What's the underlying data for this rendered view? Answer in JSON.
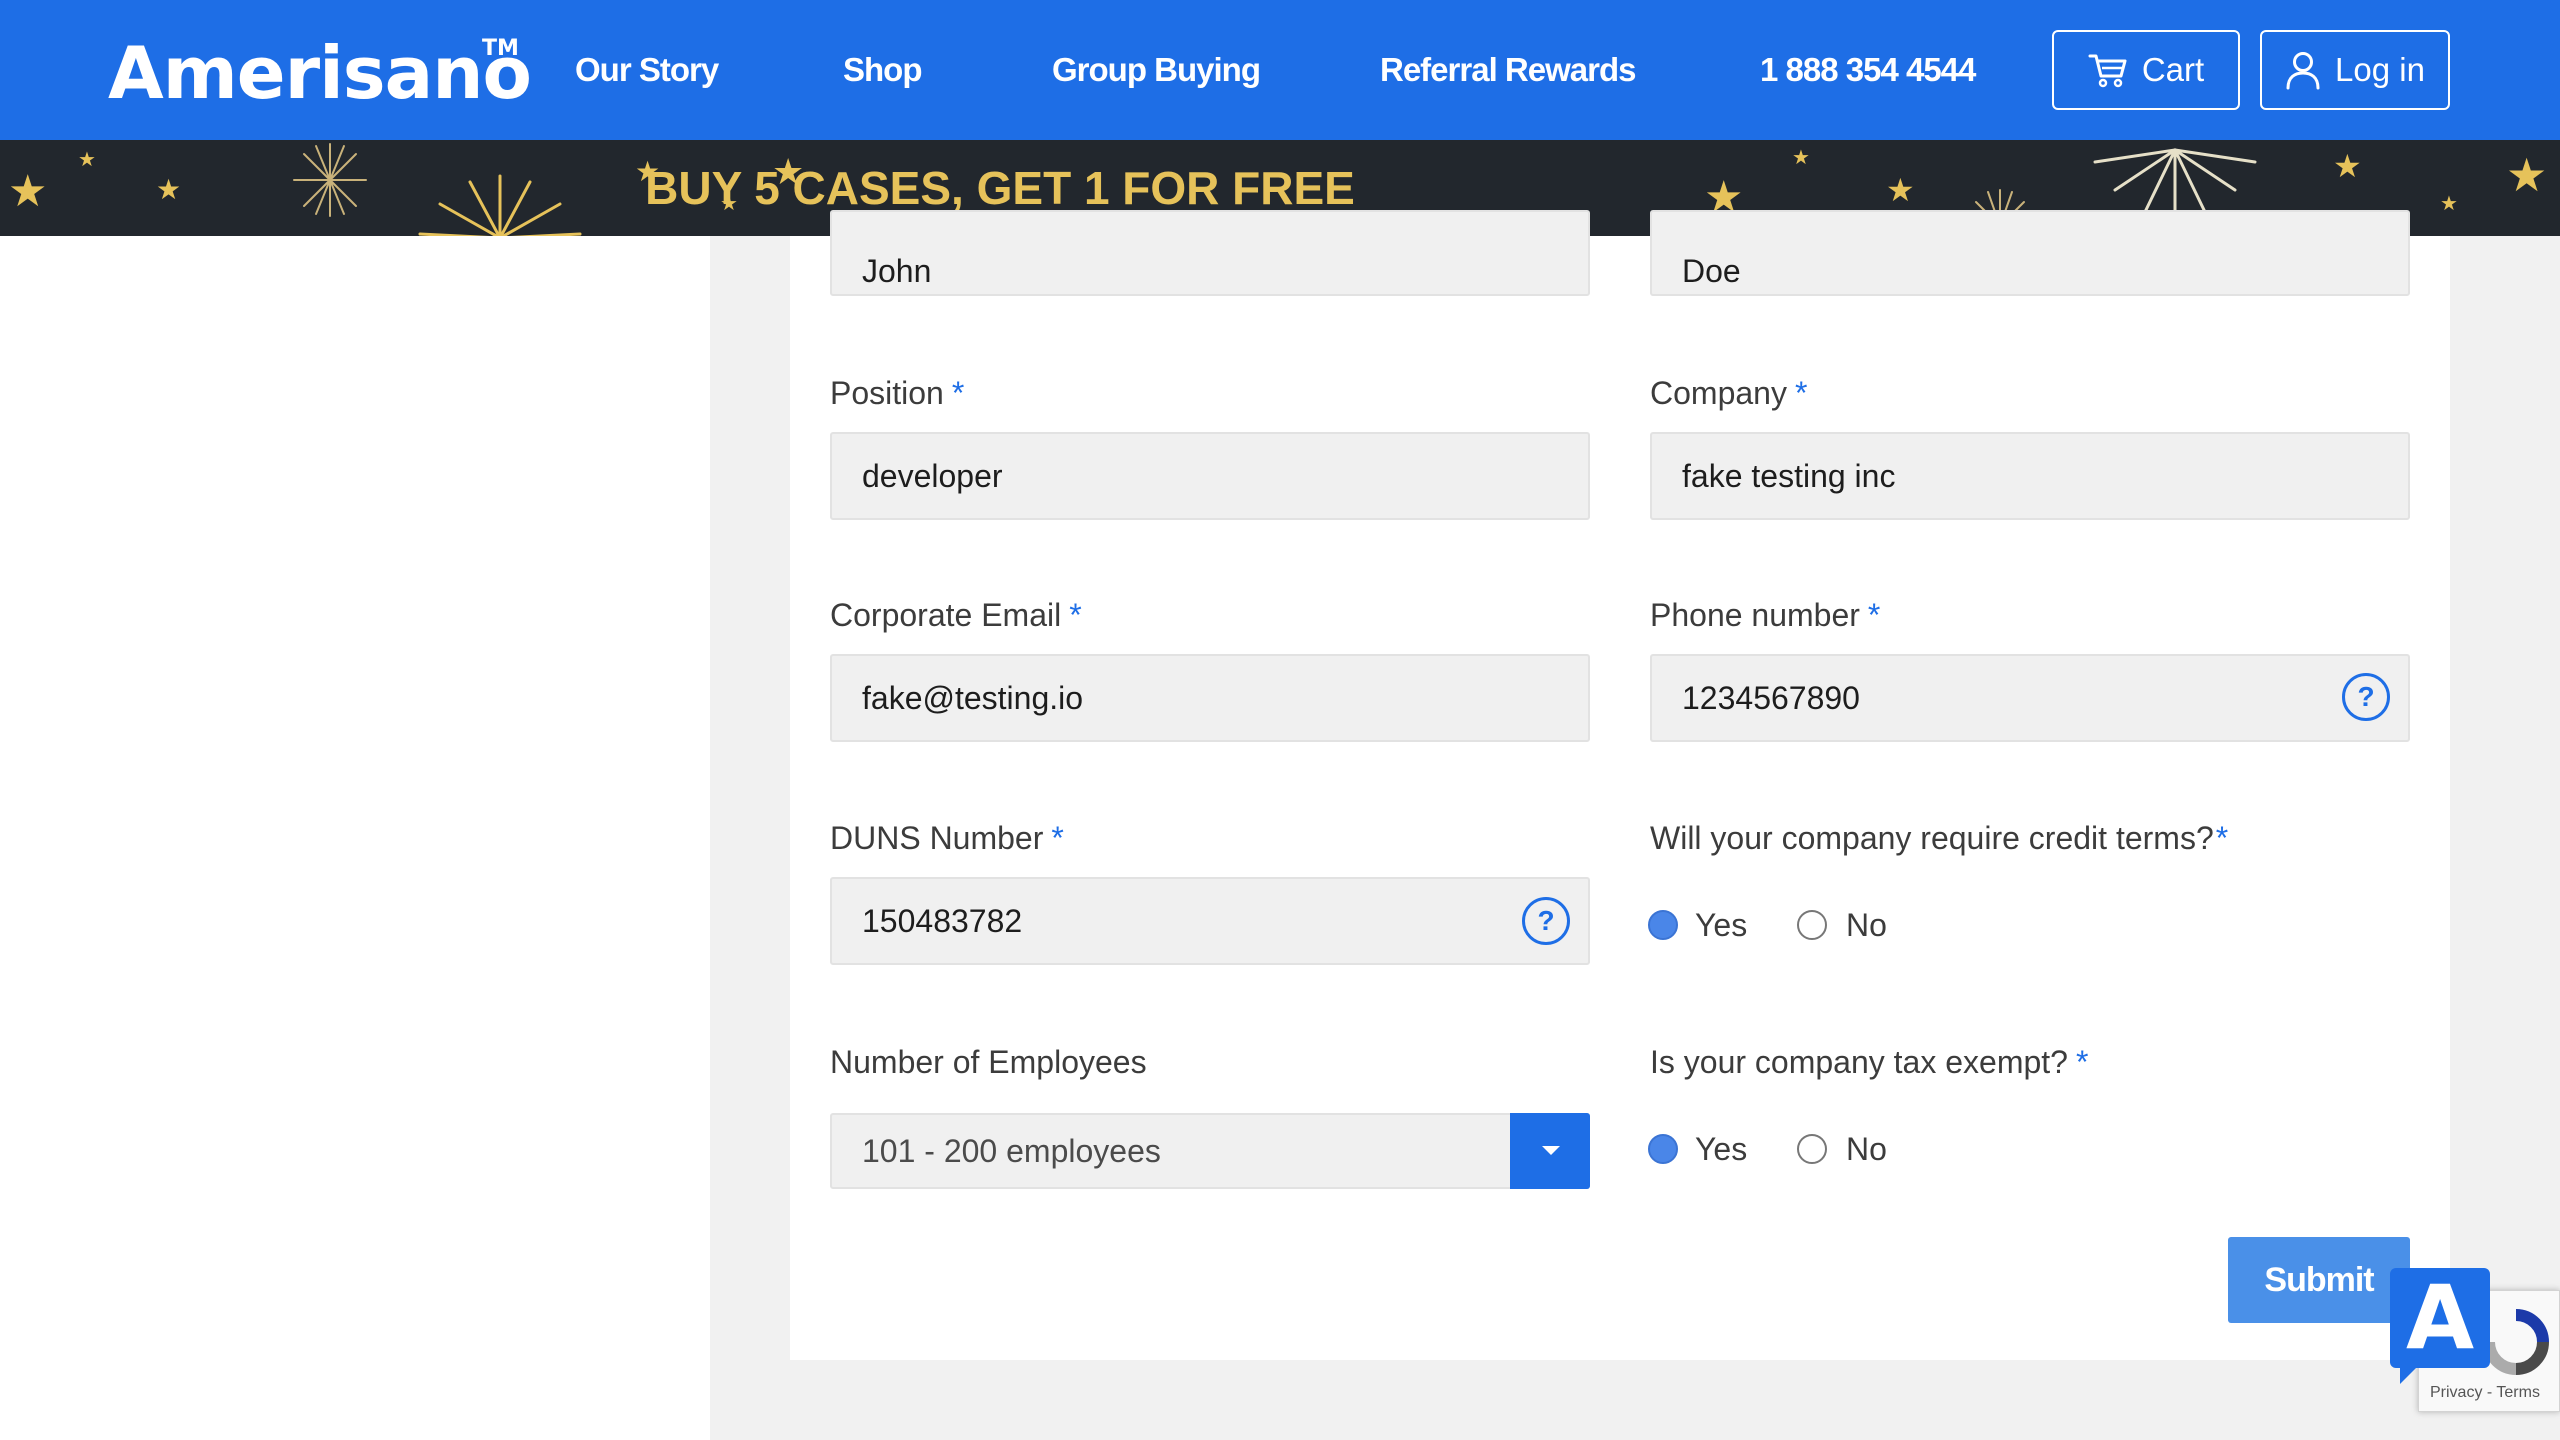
{
  "header": {
    "logo": "Amerisano",
    "logo_mark": "TM",
    "nav": [
      "Our Story",
      "Shop",
      "Group Buying",
      "Referral Rewards",
      "1 888 354 4544"
    ],
    "cart_label": "Cart",
    "login_label": "Log in",
    "cart_icon": "cart-icon",
    "login_icon": "user-icon"
  },
  "banner": {
    "text": "BUY 5 CASES, GET 1 FOR FREE"
  },
  "form": {
    "first_name_value": "John",
    "last_name_value": "Doe",
    "position": {
      "label": "Position",
      "required": "*",
      "value": "developer"
    },
    "company": {
      "label": "Company",
      "required": "*",
      "value": "fake testing inc"
    },
    "email": {
      "label": "Corporate Email",
      "required": "*",
      "value": "fake@testing.io"
    },
    "phone": {
      "label": "Phone number",
      "required": "*",
      "value": "1234567890",
      "help": "?"
    },
    "duns": {
      "label": "DUNS Number",
      "required": "*",
      "value": "150483782",
      "help": "?"
    },
    "credit_terms": {
      "label": "Will your company require credit terms?",
      "required": "*",
      "options": [
        "Yes",
        "No"
      ],
      "selected": "Yes"
    },
    "employees": {
      "label": "Number of Employees",
      "selected": "101 - 200 employees"
    },
    "tax_exempt": {
      "label": "Is your company tax exempt?",
      "required": "*",
      "options": [
        "Yes",
        "No"
      ],
      "selected": "Yes"
    },
    "submit_label": "Submit"
  },
  "recaptcha": {
    "terms": "Privacy - Terms"
  },
  "accessibility_badge": "A",
  "colors": {
    "brand_blue": "#1e6ee6",
    "banner_bg": "#22272d",
    "banner_gold": "#e6c25a",
    "submit_blue": "#4a90e8"
  }
}
